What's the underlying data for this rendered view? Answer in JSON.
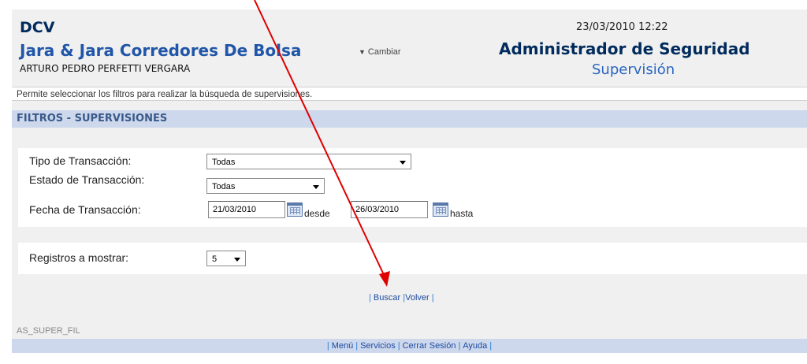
{
  "header": {
    "org": "DCV",
    "company": "Jara & Jara Corredores De Bolsa",
    "user": "ARTURO PEDRO PERFETTI VERGARA",
    "change_label": "Cambiar",
    "datetime": "23/03/2010 12:22",
    "module": "Administrador de Seguridad",
    "section": "Supervisión"
  },
  "description": "Permite seleccionar los filtros para realizar la búsqueda de supervisiones.",
  "filters": {
    "title": "FILTROS - SUPERVISIONES",
    "tipo": {
      "label": "Tipo de Transacción:",
      "value": "Todas"
    },
    "estado": {
      "label": "Estado de Transacción:",
      "value": "Todas"
    },
    "fecha": {
      "label": "Fecha de Transacción:",
      "from_value": "21/03/2010",
      "from_suffix": "desde",
      "to_value": "26/03/2010",
      "to_suffix": "hasta"
    },
    "registros": {
      "label": "Registros a mostrar:",
      "value": "5"
    }
  },
  "actions": {
    "sep": "|",
    "buscar": "Buscar",
    "volver": "Volver"
  },
  "screen_code": "AS_SUPER_FIL",
  "footer": {
    "sep": "|",
    "menu": "Menú",
    "servicios": "Servicios",
    "cerrar": "Cerrar Sesión",
    "ayuda": "Ayuda"
  },
  "colors": {
    "accent_blue": "#2056a8",
    "section_bar": "#cdd8ec",
    "annotation_arrow": "#e00000"
  }
}
